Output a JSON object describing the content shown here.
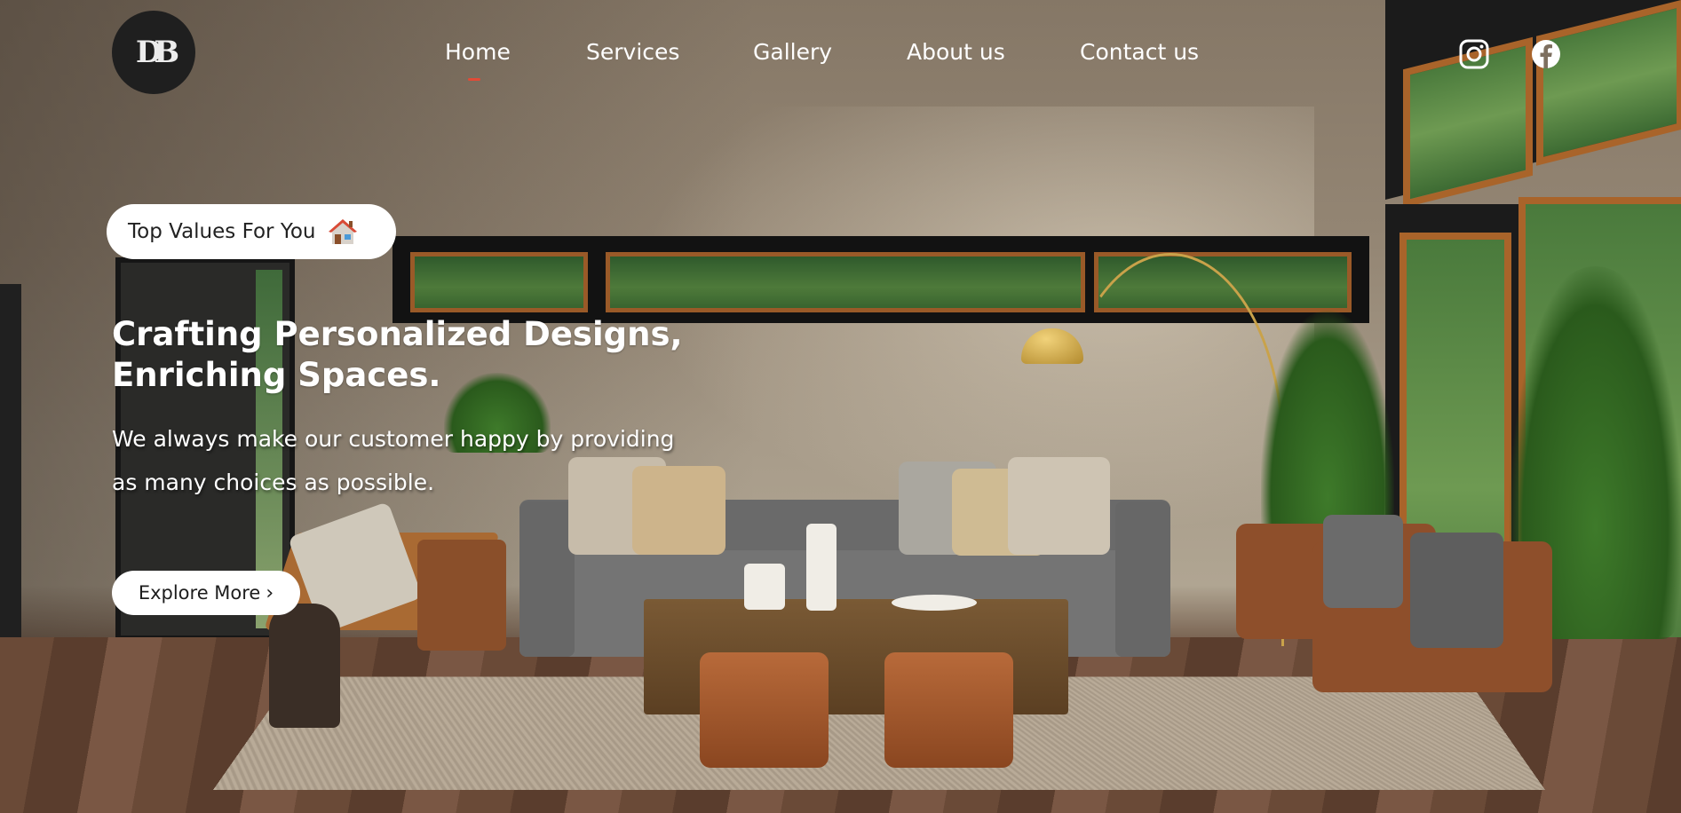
{
  "brand": {
    "logo_text": "DB"
  },
  "nav": {
    "items": [
      {
        "label": "Home",
        "active": true
      },
      {
        "label": "Services"
      },
      {
        "label": "Gallery"
      },
      {
        "label": "About us"
      },
      {
        "label": "Contact us"
      }
    ],
    "active_indicator_color": "#e24a36"
  },
  "social": {
    "icons": [
      "instagram-icon",
      "facebook-icon"
    ]
  },
  "hero": {
    "badge_label": "Top Values For You",
    "badge_icon": "house-icon",
    "headline_line1": "Crafting Personalized Designs,",
    "headline_line2": "Enriching Spaces.",
    "subtext_line1": "We always make our customer happy by providing",
    "subtext_line2": "as many choices as possible.",
    "cta_label": "Explore More",
    "cta_icon": "chevron-right-icon"
  },
  "colors": {
    "text": "#ffffff",
    "button_bg": "#ffffff",
    "logo_bg": "#1f1f1f"
  }
}
